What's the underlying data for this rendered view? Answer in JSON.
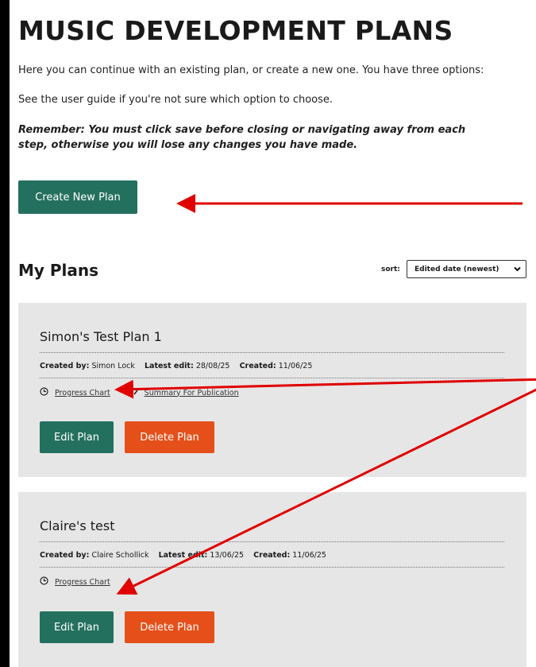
{
  "page": {
    "title": "MUSIC DEVELOPMENT PLANS",
    "intro_line1": "Here you can continue with an existing plan, or create a new one. You have three options:",
    "intro_line2": "See the user guide if you're not sure which option to choose.",
    "remember": "Remember: You must click save before closing or navigating away from each step, otherwise you will lose any changes you have made.",
    "create_button": "Create New Plan"
  },
  "my_plans": {
    "heading": "My Plans",
    "sort_label": "sort:",
    "sort_value": "Edited date (newest)",
    "plans": [
      {
        "title": "Simon's Test Plan 1",
        "created_by_label": "Created by:",
        "created_by": "Simon Lock",
        "latest_edit_label": "Latest edit:",
        "latest_edit": "28/08/25",
        "created_label": "Created:",
        "created": "11/06/25",
        "progress_chart": "Progress Chart",
        "summary": "Summary For Publication",
        "edit": "Edit Plan",
        "delete": "Delete Plan"
      },
      {
        "title": "Claire's test",
        "created_by_label": "Created by:",
        "created_by": "Claire Schollick",
        "latest_edit_label": "Latest edit:",
        "latest_edit": "13/06/25",
        "created_label": "Created:",
        "created": "11/06/25",
        "progress_chart": "Progress Chart",
        "edit": "Edit Plan",
        "delete": "Delete Plan"
      }
    ]
  },
  "colors": {
    "primary_button": "#24705f",
    "danger_button": "#e5501a",
    "card_bg": "#e6e6e6",
    "annotation_arrow": "#e00000"
  },
  "icons": {
    "progress": "clock-icon",
    "summary": "edit-list-icon",
    "sort_caret": "chevron-down-icon"
  }
}
